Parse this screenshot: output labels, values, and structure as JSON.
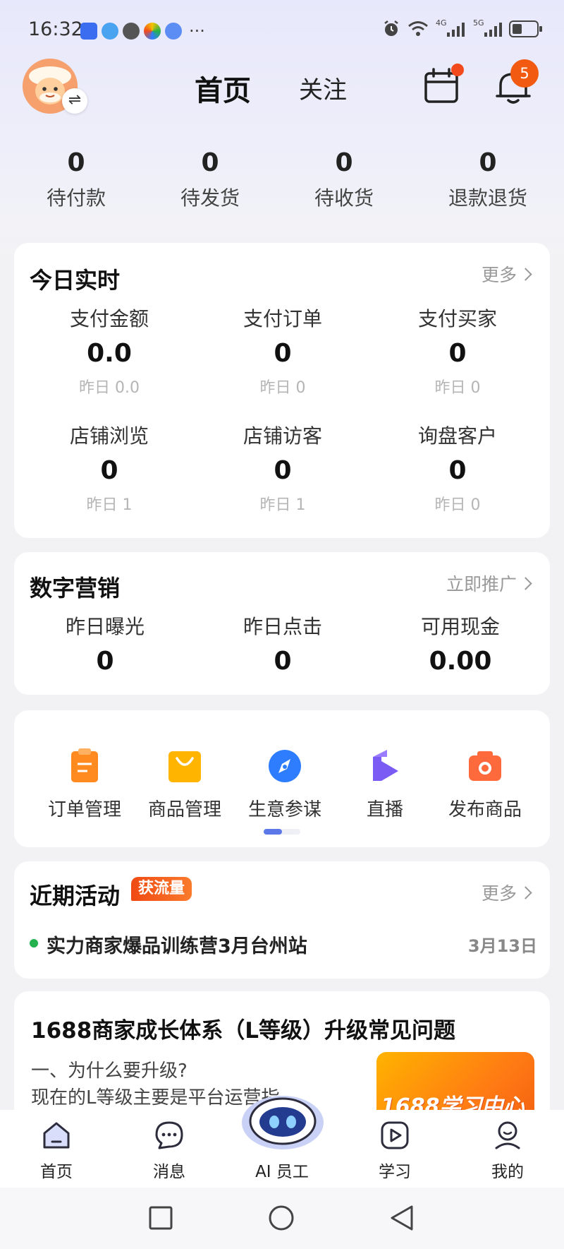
{
  "status_bar": {
    "time": "16:32",
    "net_4g": "4G",
    "net_5g": "5G",
    "more": "···"
  },
  "header": {
    "tab_home": "首页",
    "tab_follow": "关注",
    "swap_glyph": "⇌",
    "notification_count": "5"
  },
  "order_stats": [
    {
      "value": "0",
      "label": "待付款"
    },
    {
      "value": "0",
      "label": "待发货"
    },
    {
      "value": "0",
      "label": "待收货"
    },
    {
      "value": "0",
      "label": "退款退货"
    }
  ],
  "realtime": {
    "title": "今日实时",
    "more": "更多",
    "metrics": [
      {
        "label": "支付金额",
        "value": "0.0",
        "yesterday": "昨日 0.0"
      },
      {
        "label": "支付订单",
        "value": "0",
        "yesterday": "昨日 0"
      },
      {
        "label": "支付买家",
        "value": "0",
        "yesterday": "昨日 0"
      },
      {
        "label": "店铺浏览",
        "value": "0",
        "yesterday": "昨日 1"
      },
      {
        "label": "店铺访客",
        "value": "0",
        "yesterday": "昨日 1"
      },
      {
        "label": "询盘客户",
        "value": "0",
        "yesterday": "昨日 0"
      }
    ]
  },
  "marketing": {
    "title": "数字营销",
    "action": "立即推广",
    "metrics": [
      {
        "label": "昨日曝光",
        "value": "0"
      },
      {
        "label": "昨日点击",
        "value": "0"
      },
      {
        "label": "可用现金",
        "value": "0.00"
      }
    ]
  },
  "tools": [
    {
      "label": "订单管理",
      "icon": "clipboard-icon",
      "color": "#ff8a1f"
    },
    {
      "label": "商品管理",
      "icon": "shopping-bag-icon",
      "color": "#ffb400"
    },
    {
      "label": "生意参谋",
      "icon": "compass-icon",
      "color": "#2f7dff"
    },
    {
      "label": "直播",
      "icon": "live-icon",
      "color": "#7a5cf5"
    },
    {
      "label": "发布商品",
      "icon": "camera-icon",
      "color": "#ff6a3d"
    }
  ],
  "activity": {
    "title": "近期活动",
    "badge": "获流量",
    "more": "更多",
    "item_title": "实力商家爆品训练营3月台州站",
    "item_date": "3月13日"
  },
  "article": {
    "title": "1688商家成长体系（L等级）升级常见问题",
    "question": "一、为什么要升级?",
    "body": "现在的L等级主要是平台运营指标，...",
    "thumb_text": "1688学习中心"
  },
  "bottom_nav": [
    {
      "label": "首页",
      "icon": "home-icon"
    },
    {
      "label": "消息",
      "icon": "message-icon"
    },
    {
      "label": "AI 员工",
      "icon": "ai-robot-icon"
    },
    {
      "label": "学习",
      "icon": "play-icon"
    },
    {
      "label": "我的",
      "icon": "profile-icon"
    }
  ],
  "colors": {
    "accent": "#f25a12",
    "pager": "#5b77e8",
    "dot_green": "#22b14c"
  }
}
